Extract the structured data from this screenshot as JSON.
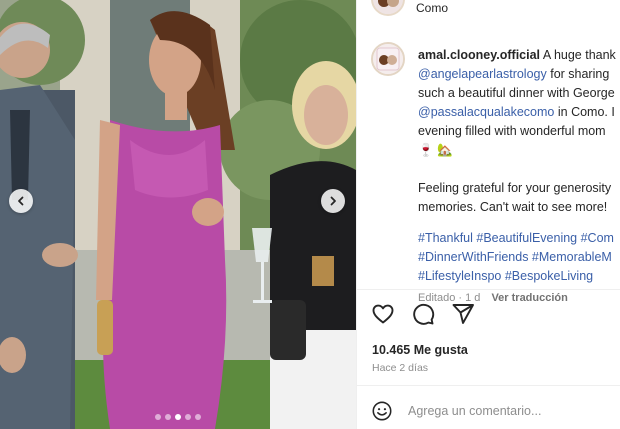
{
  "post": {
    "location": "Como",
    "username": "amal.clooney.official",
    "caption_lines": [
      {
        "type": "text",
        "text": "A huge thank"
      },
      {
        "type": "mention",
        "text": "@angelapearlastrology",
        "suffix": " for sharing"
      },
      {
        "type": "text",
        "text": "such a beautiful dinner with George"
      },
      {
        "type": "mention",
        "text": "@passalacqualakecomo",
        "suffix": " in Como. I"
      },
      {
        "type": "text",
        "text": "evening filled with wonderful mom"
      }
    ],
    "emoji_line": "🍷 🏡",
    "second_paragraph": [
      "Feeling grateful for your generosity",
      "memories. Can't wait to see more!"
    ],
    "hashtag_lines": [
      "#Thankful #BeautifulEvening #Com",
      "#DinnerWithFriends #MemorableM",
      "#LifestyleInspo #BespokeLiving"
    ],
    "edited_label": "Editado · 1 d",
    "translate_label": "Ver traducción",
    "likes_label": "10.465 Me gusta",
    "time_ago": "Hace 2 días",
    "comment_placeholder": "Agrega un comentario..."
  },
  "media": {
    "carousel_count": 5,
    "carousel_active_index": 2
  },
  "icons": {
    "prev": "chevron-left-icon",
    "next": "chevron-right-icon",
    "like": "heart-icon",
    "comment": "comment-bubble-icon",
    "share": "paper-plane-icon",
    "emoji": "smiley-icon"
  },
  "colors": {
    "link": "#3a5fa8",
    "muted": "#8e8e8e",
    "text": "#262626"
  }
}
